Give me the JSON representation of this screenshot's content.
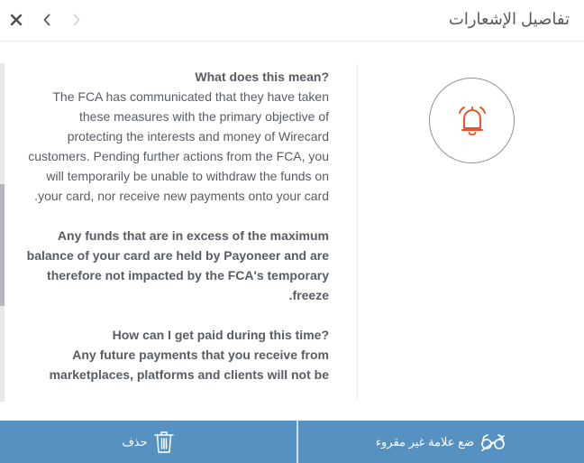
{
  "header": {
    "title": "تفاصيل الإشعارات",
    "close_icon": "close-icon",
    "back_icon": "chevron-left-icon",
    "forward_icon": "chevron-right-icon"
  },
  "notification": {
    "icon": "bell-ringing-icon",
    "accent_color": "#e8552b",
    "q1": "?What does this mean",
    "p1": "The FCA has communicated that they have taken these measures with the primary objective of protecting the interests and money of Wirecard customers. Pending further actions from the FCA, you will temporarily be unable to withdraw the funds on your card, nor receive new payments onto your card.",
    "p2": "Any funds that are in excess of the maximum balance of your card are held by Payoneer and are therefore not impacted by the FCA's temporary freeze.",
    "q2": "?How can I get paid during this time",
    "p3": "Any future payments that you receive from marketplaces, platforms and clients will not be"
  },
  "footer": {
    "mark_unread_label": "ضع علامة غير مقروء",
    "mark_unread_icon": "glasses-off-icon",
    "delete_label": "حذف",
    "delete_icon": "trash-icon",
    "bar_color": "#5592c1"
  }
}
